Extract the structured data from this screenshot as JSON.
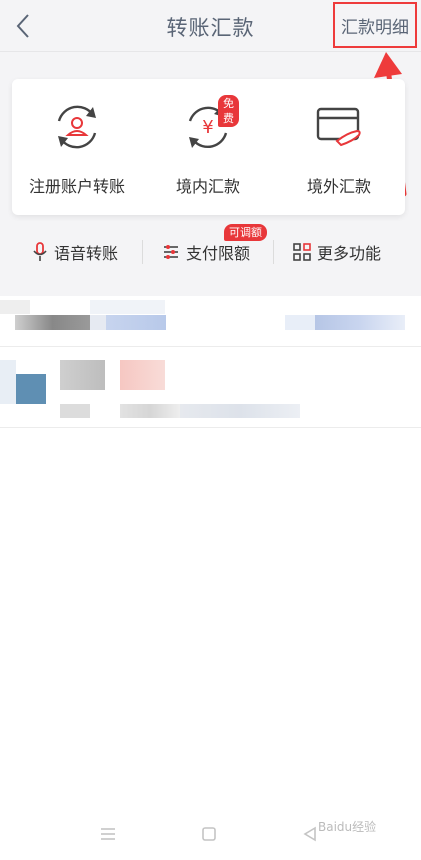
{
  "header": {
    "title": "转账汇款",
    "detail_label": "汇款明细"
  },
  "services": [
    {
      "label": "注册账户转账",
      "icon": "person-refresh-icon",
      "badge": ""
    },
    {
      "label": "境内汇款",
      "icon": "yen-refresh-icon",
      "badge": "免费"
    },
    {
      "label": "境外汇款",
      "icon": "card-hand-icon",
      "badge": ""
    }
  ],
  "quick_actions": [
    {
      "label": "语音转账",
      "icon": "microphone-icon",
      "badge": ""
    },
    {
      "label": "支付限额",
      "icon": "sliders-icon",
      "badge": "可调额"
    },
    {
      "label": "更多功能",
      "icon": "grid-icon",
      "badge": ""
    }
  ],
  "colors": {
    "accent_red": "#e8373a",
    "annotation_red": "#ee3b3b",
    "title_gray": "#5a6576",
    "page_bg": "#f4f4f6"
  },
  "watermark": "Baidu经验"
}
